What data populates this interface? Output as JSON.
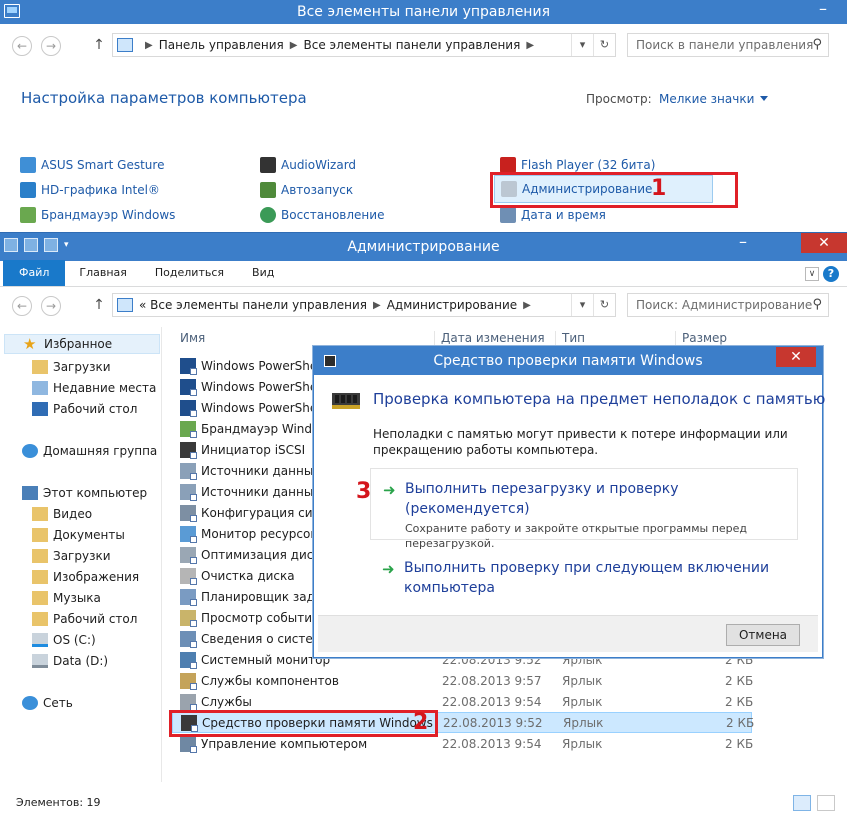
{
  "control_panel": {
    "title": "Все элементы панели управления",
    "breadcrumb": [
      "Панель управления",
      "Все элементы панели управления"
    ],
    "search_placeholder": "Поиск в панели управления",
    "heading": "Настройка параметров компьютера",
    "view_by_label": "Просмотр:",
    "view_by_value": "Мелкие значки",
    "items": [
      {
        "label": "ASUS Smart Gesture",
        "icon": "touchpad-icon"
      },
      {
        "label": "HD-графика Intel®",
        "icon": "intel-graphics-icon"
      },
      {
        "label": "Брандмауэр Windows",
        "icon": "firewall-icon"
      },
      {
        "label": "AudioWizard",
        "icon": "audio-wizard-icon"
      },
      {
        "label": "Автозапуск",
        "icon": "autoplay-icon"
      },
      {
        "label": "Восстановление",
        "icon": "recovery-icon"
      },
      {
        "label": "Flash Player (32 бита)",
        "icon": "flash-player-icon"
      },
      {
        "label": "Администрирование",
        "icon": "admin-tools-icon"
      },
      {
        "label": "Дата и время",
        "icon": "date-time-icon"
      }
    ],
    "step_marker": "1"
  },
  "admin_window": {
    "title": "Администрирование",
    "ribbon_tabs": [
      "Файл",
      "Главная",
      "Поделиться",
      "Вид"
    ],
    "breadcrumb": [
      "« Все элементы панели управления",
      "Администрирование"
    ],
    "search_placeholder": "Поиск: Администрирование",
    "nav": {
      "favorites": "Избранное",
      "favorites_items": [
        "Загрузки",
        "Недавние места",
        "Рабочий стол"
      ],
      "homegroup": "Домашняя группа",
      "this_pc": "Этот компьютер",
      "this_pc_items": [
        "Видео",
        "Документы",
        "Загрузки",
        "Изображения",
        "Музыка",
        "Рабочий стол",
        "OS (C:)",
        "Data (D:)"
      ],
      "network": "Сеть"
    },
    "columns": {
      "name": "Имя",
      "date": "Дата изменения",
      "type": "Тип",
      "size": "Размер"
    },
    "files": [
      {
        "name": "Windows PowerShell",
        "date": "",
        "type": "",
        "size": ""
      },
      {
        "name": "Windows PowerShell",
        "date": "",
        "type": "",
        "size": ""
      },
      {
        "name": "Windows PowerShell",
        "date": "",
        "type": "",
        "size": ""
      },
      {
        "name": "Брандмауэр Window",
        "date": "",
        "type": "",
        "size": ""
      },
      {
        "name": "Инициатор iSCSI",
        "date": "",
        "type": "",
        "size": ""
      },
      {
        "name": "Источники данных С",
        "date": "",
        "type": "",
        "size": ""
      },
      {
        "name": "Источники данных С",
        "date": "",
        "type": "",
        "size": ""
      },
      {
        "name": "Конфигурация систе",
        "date": "",
        "type": "",
        "size": ""
      },
      {
        "name": "Монитор ресурсов",
        "date": "",
        "type": "",
        "size": ""
      },
      {
        "name": "Оптимизация диско",
        "date": "",
        "type": "",
        "size": ""
      },
      {
        "name": "Очистка диска",
        "date": "",
        "type": "",
        "size": ""
      },
      {
        "name": "Планировщик задан",
        "date": "",
        "type": "",
        "size": ""
      },
      {
        "name": "Просмотр событий",
        "date": "",
        "type": "",
        "size": ""
      },
      {
        "name": "Сведения о системе",
        "date": "",
        "type": "",
        "size": ""
      },
      {
        "name": "Системный монитор",
        "date": "22.08.2013 9:52",
        "type": "Ярлык",
        "size": "2 КБ"
      },
      {
        "name": "Службы компонентов",
        "date": "22.08.2013 9:57",
        "type": "Ярлык",
        "size": "2 КБ"
      },
      {
        "name": "Службы",
        "date": "22.08.2013 9:54",
        "type": "Ярлык",
        "size": "2 КБ"
      },
      {
        "name": "Средство проверки памяти Windows",
        "date": "22.08.2013 9:52",
        "type": "Ярлык",
        "size": "2 КБ"
      },
      {
        "name": "Управление компьютером",
        "date": "22.08.2013 9:54",
        "type": "Ярлык",
        "size": "2 КБ"
      }
    ],
    "status": "Элементов: 19",
    "step_marker": "2"
  },
  "dialog": {
    "title": "Средство проверки памяти Windows",
    "heading": "Проверка компьютера на предмет неполадок с памятью",
    "description": "Неполадки с памятью могут привести к потере информации или прекращению работы компьютера.",
    "option1_title": "Выполнить перезагрузку и проверку (рекомендуется)",
    "option1_sub": "Сохраните работу и закройте открытые программы перед перезагрузкой.",
    "option2_title": "Выполнить проверку при следующем включении компьютера",
    "cancel": "Отмена",
    "step_marker": "3"
  },
  "colors": {
    "titlebar": "#3c7ec9",
    "link": "#1e5aa8",
    "highlight_box": "#e02028",
    "close_button": "#c7372f"
  }
}
